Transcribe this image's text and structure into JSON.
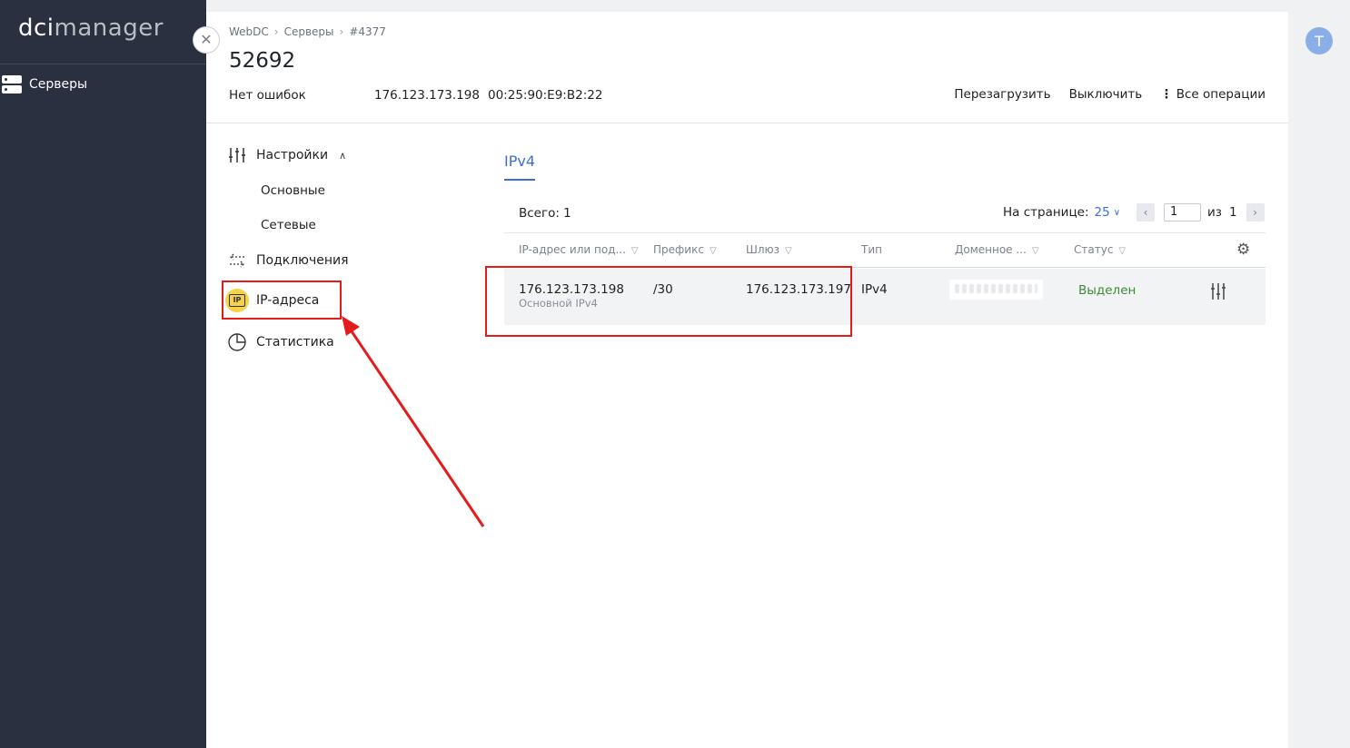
{
  "app": {
    "logo_dark": "dci",
    "logo_light": "manager",
    "nav": [
      {
        "label": "Серверы",
        "icon": "server-icon"
      }
    ],
    "avatar_initial": "T"
  },
  "header": {
    "breadcrumb": [
      "WebDC",
      "Серверы",
      "#4377"
    ],
    "title": "52692",
    "status": "Нет ошибок",
    "ip": "176.123.173.198",
    "mac": "00:25:90:E9:B2:22",
    "actions": {
      "reboot": "Перезагрузить",
      "power_off": "Выключить",
      "all_ops": "Все операции"
    }
  },
  "side_menu": {
    "settings": "Настройки",
    "basic": "Основные",
    "network": "Сетевые",
    "connections": "Подключения",
    "ip_addresses": "IP-адреса",
    "stats": "Статистика"
  },
  "content": {
    "tab": "IPv4",
    "total": "Всего: 1",
    "per_page_label": "На странице:",
    "per_page_value": "25",
    "page_current": "1",
    "page_of": "из",
    "page_total": "1",
    "columns": [
      "IP-адрес или под...",
      "Префикс",
      "Шлюз",
      "Тип",
      "Доменное ...",
      "Статус"
    ],
    "rows": [
      {
        "ip": "176.123.173.198",
        "ip_note": "Основной IPv4",
        "prefix": "/30",
        "gateway": "176.123.173.197",
        "type": "IPv4",
        "domain": "",
        "status": "Выделен"
      }
    ]
  },
  "colors": {
    "sidebar_bg": "#2b3040",
    "accent": "#3b6fd4",
    "status_ok": "#3d8b37",
    "annotation": "#e31b1b",
    "highlight_badge": "#f4d34a"
  }
}
